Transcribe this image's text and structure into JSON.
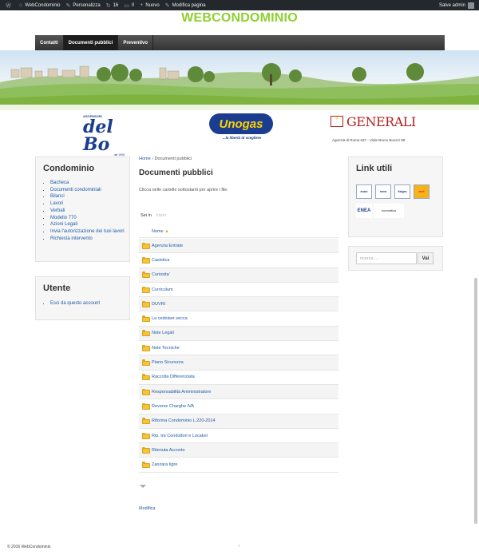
{
  "admin_bar": {
    "site_name": "WebCondominio",
    "customize": "Personalizza",
    "updates_count": "16",
    "comments_count": "0",
    "new_label": "Nuovo",
    "edit_page": "Modifica pagina",
    "greeting": "Salve admin"
  },
  "site": {
    "title": "WEBCONDOMINIO"
  },
  "nav": {
    "items": [
      {
        "label": "Contatti"
      },
      {
        "label": "Documenti pubblici"
      },
      {
        "label": "Preventivo"
      }
    ]
  },
  "sponsors": {
    "bo_small": "ASCENSORI",
    "bo_name": "del Bo",
    "bo_since": "dal 1908",
    "unogas_name": "Unogas",
    "unogas_tagline": "...la libertà di scegliere",
    "generali_name": "GENERALI",
    "generali_address": "Agenzia di Roma 637 - Viale Bruno Buozzi 98"
  },
  "sidebar_left": {
    "condominio_title": "Condominio",
    "condominio_links": [
      "Bacheca",
      "Documenti condominiali",
      "Bilanci",
      "Lavori",
      "Verbali",
      "Modello 770",
      "Azioni Legali",
      "Invia l'autorizzazione dei tuoi lavori",
      "Richiesta intervento"
    ],
    "utente_title": "Utente",
    "utente_links": [
      "Esci da questo account"
    ]
  },
  "main": {
    "breadcrumb_home": "Home",
    "breadcrumb_sep": "›",
    "breadcrumb_current": "Documenti pubblici",
    "page_title": "Documenti pubblici",
    "intro": "Clicca nelle cartelle sottostanti per aprire i file.",
    "sei_in": "Sei in",
    "root_label": "Inizio",
    "column_name": "Nome",
    "sort_arrow": "▲",
    "folders": [
      "Agenzia Entrate",
      "Casistica",
      "Curiosita'",
      "Curriculum",
      "DUVRI",
      "La cedolare secca",
      "Note Legali",
      "Note Tecniche",
      "Piano Sicurezza",
      "Raccolta Differenziata",
      "Responsabilità Amministratore",
      "Reverse Charghe IVA",
      "Riforma Condominio L.220-2014",
      "Rip. tra Conduttori e Locatori",
      "Ritenuta Acconto",
      "Zanzara tigre"
    ],
    "edit_link": "Modifica"
  },
  "sidebar_right": {
    "links_title": "Link utili",
    "link_logos": [
      "anaci",
      "roma",
      "italgas",
      "enel",
      "ENEA",
      "normattiva"
    ],
    "search_placeholder": "ricerca ...",
    "search_button": "Vai"
  },
  "footer": {
    "copyright": "© 2016 WebCondominio",
    "back_to_top": "↑"
  }
}
